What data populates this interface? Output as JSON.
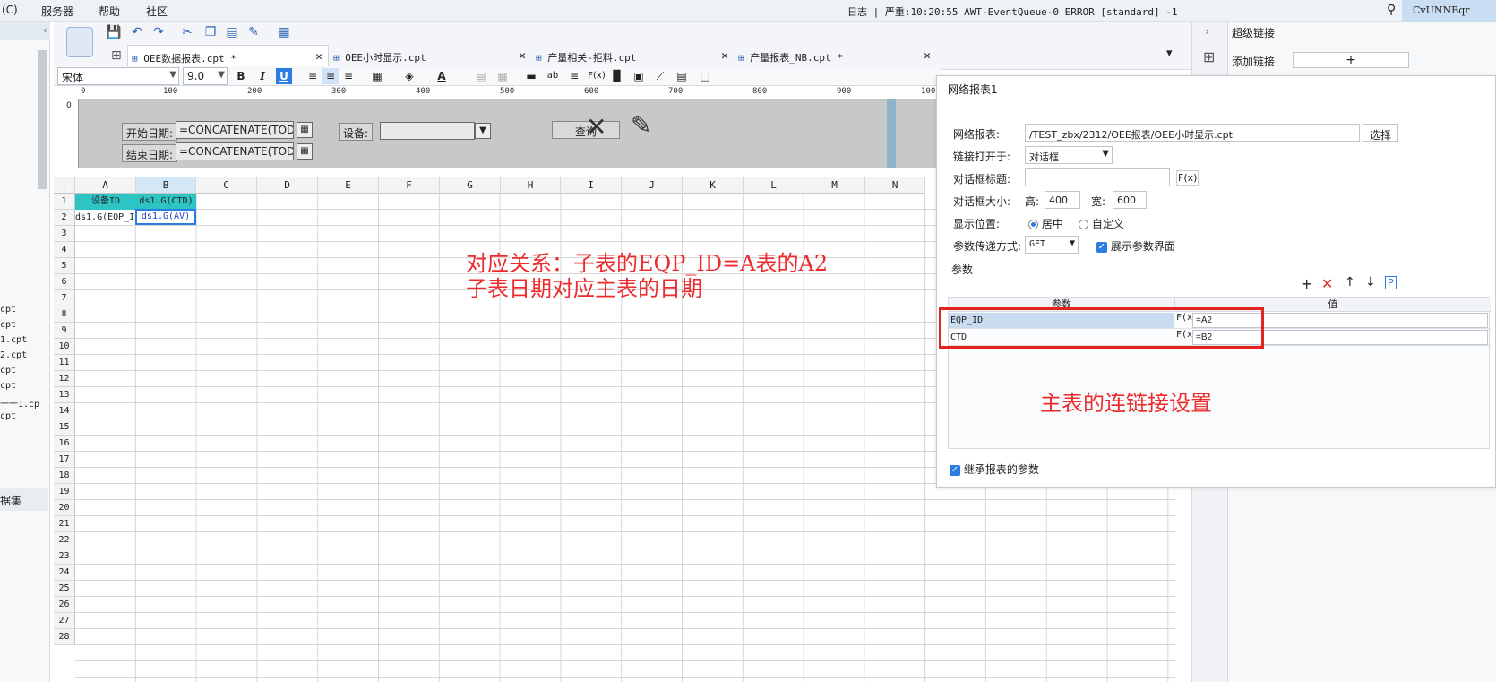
{
  "menubar": {
    "left_fragment": "(C)",
    "items": [
      "服务器",
      "帮助",
      "社区"
    ],
    "status": "日志 | 严重:10:20:55 AWT-EventQueue-0 ERROR [standard] -1",
    "user": "CvUNNBqr"
  },
  "left_panel": {
    "files": [
      "cpt",
      "cpt",
      "1.cpt",
      "2.cpt",
      "cpt",
      "cpt",
      "一一1.cp",
      "cpt"
    ],
    "dataset_label": "据集"
  },
  "tabs": [
    {
      "label": "OEE数据报表.cpt *",
      "active": true
    },
    {
      "label": "OEE小时显示.cpt",
      "active": false
    },
    {
      "label": "产量相关-拒料.cpt",
      "active": false
    },
    {
      "label": "产量报表_NB.cpt *",
      "active": false
    }
  ],
  "format_bar": {
    "font": "宋体",
    "size": "9.0",
    "bold": "B",
    "italic": "I",
    "underline": "U",
    "text_a": "A",
    "ab": "ab",
    "fx": "F(x)"
  },
  "ruler_labels": [
    "0",
    "100",
    "200",
    "300",
    "400",
    "500",
    "600",
    "700",
    "800",
    "900",
    "100"
  ],
  "param_pane": {
    "start_date_label": "开始日期:",
    "start_date_value": "=CONCATENATE(TODA'",
    "end_date_label": "结束日期:",
    "end_date_value": "=CONCATENATE(TODA'",
    "device_label": "设备:",
    "query_label": "查询",
    "ruler_zero": "0"
  },
  "grid": {
    "columns": [
      "A",
      "B",
      "C",
      "D",
      "E",
      "F",
      "G",
      "H",
      "I",
      "J",
      "K",
      "L",
      "M",
      "N"
    ],
    "rows": [
      "1",
      "2",
      "3",
      "4",
      "5",
      "6",
      "7",
      "8",
      "9",
      "10",
      "11",
      "12",
      "13",
      "14",
      "15",
      "16",
      "17",
      "18",
      "19",
      "20",
      "21",
      "22",
      "23",
      "24",
      "25",
      "26",
      "27",
      "28"
    ],
    "cells": {
      "A1": "设备ID",
      "B1": "ds1.G(CTD)",
      "A2": "ds1.G(EQP_I",
      "B2": "ds1.G(AV)"
    }
  },
  "annotations": {
    "line1": "对应关系：子表的EQP_ID=A表的A2",
    "line2": "子表日期对应主表的日期",
    "dialog_note": "主表的连链接设置"
  },
  "right_panel": {
    "title": "超级链接",
    "add_link": "添加链接",
    "add_symbol": "+"
  },
  "dialog": {
    "title": "网络报表1",
    "report_label": "网络报表:",
    "report_path": "/TEST_zbx/2312/OEE报表/OEE小时显示.cpt",
    "choose_button": "选择",
    "open_in_label": "链接打开于:",
    "open_in_value": "对话框",
    "dialog_title_label": "对话框标题:",
    "dialog_title_value": "",
    "fx": "F(x)",
    "size_label": "对话框大小:",
    "height_label": "高:",
    "height_value": "400",
    "width_label": "宽:",
    "width_value": "600",
    "position_label": "显示位置:",
    "position_center": "居中",
    "position_custom": "自定义",
    "method_label": "参数传递方式:",
    "method_value": "GET",
    "show_param_ui": "展示参数界面",
    "params_label": "参数",
    "col_param": "参数",
    "col_value": "值",
    "params": [
      {
        "name": "EQP_ID",
        "value": "=A2"
      },
      {
        "name": "CTD",
        "value": "=B2"
      }
    ],
    "inherit_label": "继承报表的参数",
    "param_action_p": "P"
  }
}
